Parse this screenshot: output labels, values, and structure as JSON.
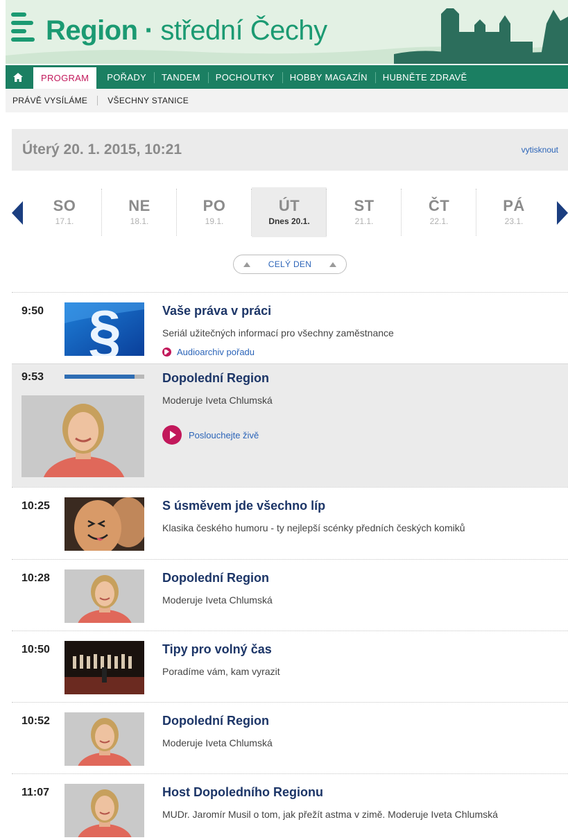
{
  "header": {
    "brand": "Region",
    "separator": "·",
    "region": "střední Čechy"
  },
  "main_nav": {
    "items": [
      {
        "label": "PROGRAM",
        "active": true
      },
      {
        "label": "POŘADY"
      },
      {
        "label": "TANDEM"
      },
      {
        "label": "POCHOUTKY"
      },
      {
        "label": "HOBBY MAGAZÍN"
      },
      {
        "label": "HUBNĚTE ZDRAVĚ"
      }
    ]
  },
  "sub_nav": {
    "items": [
      {
        "label": "PRÁVĚ VYSÍLÁME"
      },
      {
        "label": "VŠECHNY STANICE"
      }
    ]
  },
  "date_bar": {
    "date": "Úterý 20. 1. 2015, 10:21",
    "print_label": "vytisknout"
  },
  "days": [
    {
      "name": "SO",
      "date": "17.1."
    },
    {
      "name": "NE",
      "date": "18.1."
    },
    {
      "name": "PO",
      "date": "19.1."
    },
    {
      "name": "ÚT",
      "date": "Dnes 20.1.",
      "active": true
    },
    {
      "name": "ST",
      "date": "21.1."
    },
    {
      "name": "ČT",
      "date": "22.1."
    },
    {
      "name": "PÁ",
      "date": "23.1."
    }
  ],
  "whole_day_label": "CELÝ DEN",
  "programs": [
    {
      "time": "9:50",
      "title": "Vaše práva v práci",
      "desc": "Seriál užitečných informací pro všechny zaměstnance",
      "link": "Audioarchiv pořadu",
      "thumb": "paragraph-logo"
    },
    {
      "time": "9:53",
      "title": "Dopolední Region",
      "desc": "Moderuje Iveta Chlumská",
      "link": "Poslouchejte živě",
      "live": true,
      "progress": 0.88,
      "thumb": "presenter-photo"
    },
    {
      "time": "10:25",
      "title": "S úsměvem jde všechno líp",
      "desc": "Klasika českého humoru - ty nejlepší scénky předních českých komiků",
      "thumb": "egg-photo"
    },
    {
      "time": "10:28",
      "title": "Dopolední Region",
      "desc": "Moderuje Iveta Chlumská",
      "thumb": "presenter-photo"
    },
    {
      "time": "10:50",
      "title": "Tipy pro volný čas",
      "desc": "Poradíme vám, kam vyrazit",
      "thumb": "stage-photo"
    },
    {
      "time": "10:52",
      "title": "Dopolední Region",
      "desc": "Moderuje Iveta Chlumská",
      "thumb": "presenter-photo"
    },
    {
      "time": "11:07",
      "title": "Host Dopoledního Regionu",
      "desc": "MUDr. Jaromír Musil o tom, jak přežít astma v zimě. Moderuje Iveta Chlumská",
      "thumb": "presenter-photo"
    }
  ],
  "colors": {
    "brand_green": "#1b9a72",
    "nav_green": "#1b7f62",
    "accent_pink": "#c2185b",
    "title_navy": "#1c3567",
    "link_blue": "#2b64b8"
  }
}
